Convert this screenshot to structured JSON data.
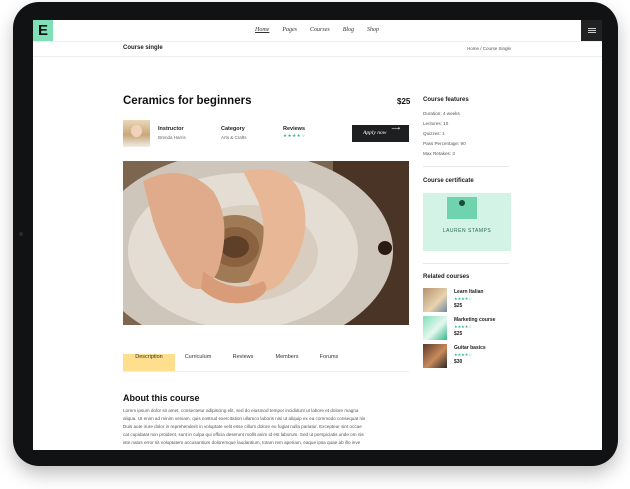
{
  "header": {
    "logo": "E",
    "nav": [
      "Home",
      "Pages",
      "Courses",
      "Blog",
      "Shop"
    ],
    "active_nav": "Home"
  },
  "breadcrumb": {
    "title": "Course single",
    "path": "Home / Course Single"
  },
  "course": {
    "title": "Ceramics for beginners",
    "price": "$25",
    "instructor_label": "Instructor",
    "instructor_name": "Brenda Harris",
    "category_label": "Category",
    "category_value": "Arts & Crafts",
    "reviews_label": "Reviews",
    "reviews_stars": "★★★★☆",
    "apply_label": "Apply now",
    "apply_icon": "arrow-right-icon"
  },
  "tabs": [
    "Description",
    "Curriculum",
    "Reviews",
    "Members",
    "Forums"
  ],
  "about": {
    "title": "About this course",
    "lines": [
      "Lorem ipsum dolor sit amet, consectetur adipiscing elit, sed do eiusmod tempor incididunt ut labore et dolore magna",
      "aliqua. Ut enim ad minim veniam, quis nostrud exercitation ullamco laboris nisi ut aliquip ex ea commodo consequat nis",
      "Duis aute irure dolor in reprehenderit in voluptate velit esse cillum dolore eu fugiat nulla pariatur. Excepteur sint occae",
      "cat cupidatat non proident, sunt in culpa qui officia deserunt mollit anim id est laborum. Sed ut perspiciatis unde om nis",
      "iste natus error sit voluptatem accusantium doloremque laudantium, totam rem aperiam, eaque ipsa quae ab illo inve"
    ]
  },
  "sidebar": {
    "features_title": "Course features",
    "features": [
      "Duration: 4 weeks",
      "Lectures: 10",
      "Quizzes: 1",
      "Pass Percentage: 90",
      "Max Retakes: 3"
    ],
    "certificate_title": "Course certificate",
    "certificate_name": "LAUREN STAMPS",
    "related_title": "Related courses",
    "related": [
      {
        "name": "Learn Italian",
        "stars": "★★★★☆",
        "price": "$25"
      },
      {
        "name": "Marketing course",
        "stars": "★★★★☆",
        "price": "$25"
      },
      {
        "name": "Guitar basics",
        "stars": "★★★★☆",
        "price": "$30"
      }
    ]
  },
  "colors": {
    "accent_green": "#7fe0b8",
    "tab_active": "#ffdf8d",
    "button_dark": "#1e1f21",
    "star": "#2fb98a"
  }
}
